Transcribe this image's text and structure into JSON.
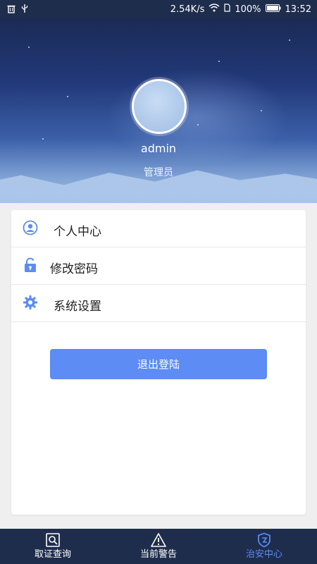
{
  "status_bar": {
    "network_speed": "2.54K/s",
    "battery": "100%",
    "time": "13:52"
  },
  "profile": {
    "username": "admin",
    "role": "管理员"
  },
  "menu": {
    "items": [
      {
        "label": "个人中心",
        "icon": "user-circle-icon"
      },
      {
        "label": "修改密码",
        "icon": "unlock-icon"
      },
      {
        "label": "系统设置",
        "icon": "gear-icon"
      }
    ]
  },
  "logout": {
    "label": "退出登陆"
  },
  "bottom_nav": {
    "items": [
      {
        "label": "取证查询",
        "icon": "search-doc-icon",
        "active": false
      },
      {
        "label": "当前警告",
        "icon": "warning-icon",
        "active": false
      },
      {
        "label": "治安中心",
        "icon": "shield-icon",
        "active": true
      }
    ]
  },
  "colors": {
    "accent": "#5c8cf4",
    "nav_bg": "#1f2d4d",
    "page_bg": "#efefef"
  }
}
